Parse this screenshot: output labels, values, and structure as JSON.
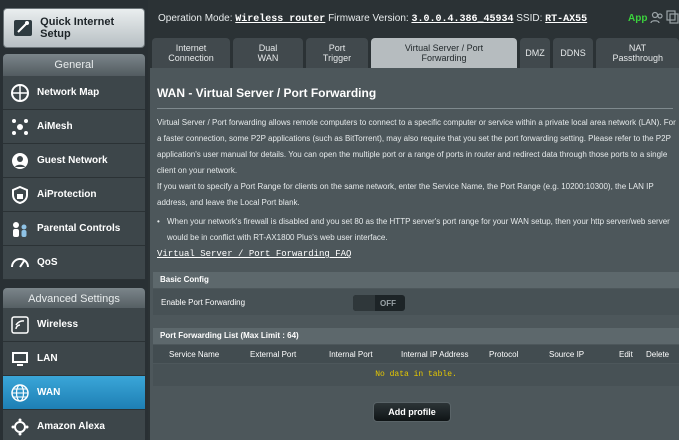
{
  "sidebar": {
    "quick_setup": "Quick Internet Setup",
    "general_header": "General",
    "general_items": [
      {
        "label": "Network Map",
        "icon": "network-map-icon"
      },
      {
        "label": "AiMesh",
        "icon": "aimesh-icon"
      },
      {
        "label": "Guest Network",
        "icon": "guest-network-icon"
      },
      {
        "label": "AiProtection",
        "icon": "shield-lock-icon"
      },
      {
        "label": "Parental Controls",
        "icon": "family-icon"
      },
      {
        "label": "QoS",
        "icon": "speedometer-icon"
      }
    ],
    "advanced_header": "Advanced Settings",
    "advanced_items": [
      {
        "label": "Wireless",
        "icon": "wifi-icon"
      },
      {
        "label": "LAN",
        "icon": "monitor-icon"
      },
      {
        "label": "WAN",
        "icon": "globe-icon",
        "active": true
      },
      {
        "label": "Amazon Alexa",
        "icon": "alexa-icon"
      }
    ]
  },
  "topbar": {
    "mode_label": "Operation Mode:",
    "mode_value": "Wireless router",
    "fw_label": "Firmware Version:",
    "fw_value": "3.0.0.4.386_45934",
    "ssid_label": "SSID:",
    "ssid_value": "RT-AX55",
    "app_label": "App",
    "accent_green": "#3bd23d"
  },
  "tabs": [
    {
      "label": "Internet Connection"
    },
    {
      "label": "Dual WAN"
    },
    {
      "label": "Port Trigger"
    },
    {
      "label": "Virtual Server / Port Forwarding",
      "active": true
    },
    {
      "label": "DMZ"
    },
    {
      "label": "DDNS"
    },
    {
      "label": "NAT Passthrough"
    }
  ],
  "main": {
    "title": "WAN - Virtual Server / Port Forwarding",
    "description": "Virtual Server / Port forwarding allows remote computers to connect to a specific computer or service within a private local area network (LAN). For a faster connection, some P2P applications (such as BitTorrent), may also require that you set the port forwarding setting. Please refer to the P2P application's user manual for details. You can open the multiple port or a range of ports in router and redirect data through those ports to a single client on your network.",
    "description2": "If you want to specify a Port Range for clients on the same network, enter the Service Name, the Port Range (e.g. 10200:10300), the LAN IP address, and leave the Local Port blank.",
    "bullet": "When your network's firewall is disabled and you set 80 as the HTTP server's port range for your WAN setup, then your http server/web server would be in conflict with RT-AX1800 Plus's web user interface.",
    "faq_link": "Virtual Server / Port Forwarding FAQ",
    "basic_config": {
      "header": "Basic Config",
      "enable_label": "Enable Port Forwarding",
      "toggle_state": "OFF"
    },
    "list": {
      "header": "Port Forwarding List (Max Limit : 64)",
      "columns": [
        "Service Name",
        "External Port",
        "Internal Port",
        "Internal IP Address",
        "Protocol",
        "Source IP",
        "Edit",
        "Delete"
      ],
      "empty_text": "No data in table.",
      "no_data_color": "#e6c800"
    },
    "add_button": "Add profile"
  }
}
